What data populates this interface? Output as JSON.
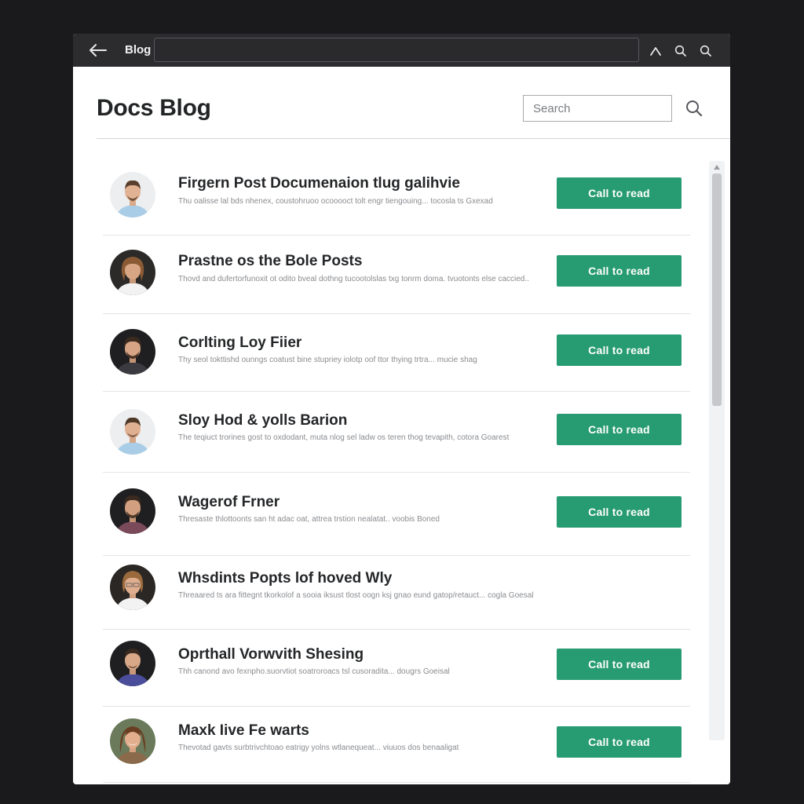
{
  "titlebar": {
    "title": "Blog",
    "address_value": ""
  },
  "icons": {
    "back": "arrow-left-icon",
    "up": "chevron-up-icon",
    "search1": "search-icon",
    "search2": "search-icon",
    "page_search": "search-icon",
    "scroll_up": "triangle-up-icon"
  },
  "header": {
    "title": "Docs Blog",
    "search_placeholder": "Search"
  },
  "colors": {
    "accent": "#279b72",
    "titlebar": "#2c2c2f",
    "background": "#1a1a1c"
  },
  "posts": [
    {
      "title": "Firgern Post Documenaion tlug galihvie",
      "excerpt": "Thu oalisse lal bds nhenex, coustohruoo ocooooct tolt engr tiengouing... tocosla ts Gxexad",
      "cta": "Call to read"
    },
    {
      "title": "Prastne os the Bole Posts",
      "excerpt": "Thovd and dufertorfunoxit ot odito bveal dothng tucootolslas txg tonrm doma. tvuotonts else caccied..",
      "cta": "Call to read"
    },
    {
      "title": "Corlting Loy Fiier",
      "excerpt": "Thy seol tokttishd ounngs coatust bine stupriey iolotp oof ttor thying trtra... mucie shag",
      "cta": "Call to read"
    },
    {
      "title": "Sloy Hod & yolls Barion",
      "excerpt": "The teqiuct trorines gost to oxdodant, muta nlog sel ladw os teren thog tevapith, cotora Goarest",
      "cta": "Call to read"
    },
    {
      "title": "Wagerof Frner",
      "excerpt": "Thresaste thlottoonts san ht adac oat, attrea trstion nealatat.. voobis Boned",
      "cta": "Call to read"
    },
    {
      "title": "Whsdints Popts lof hoved Wly",
      "excerpt": "Threaared ts ara fittegnt tkorkolof a sooia iksust tlost oogn ksj gnao eund gatop/retauct... cogla Goesal",
      "cta": ""
    },
    {
      "title": "Oprthall Vorwvith Shesing",
      "excerpt": "Thh canond avo fexnpho.suorvtiot soatroroacs tsl cusoradita... dougrs Goeisal",
      "cta": "Call to read"
    },
    {
      "title": "Maxk Iive Fe warts",
      "excerpt": "Thevotad gavts surbtrivchtoao eatrigy yolns wtlanequeat... viuuos dos benaaligat",
      "cta": "Call to read"
    }
  ]
}
